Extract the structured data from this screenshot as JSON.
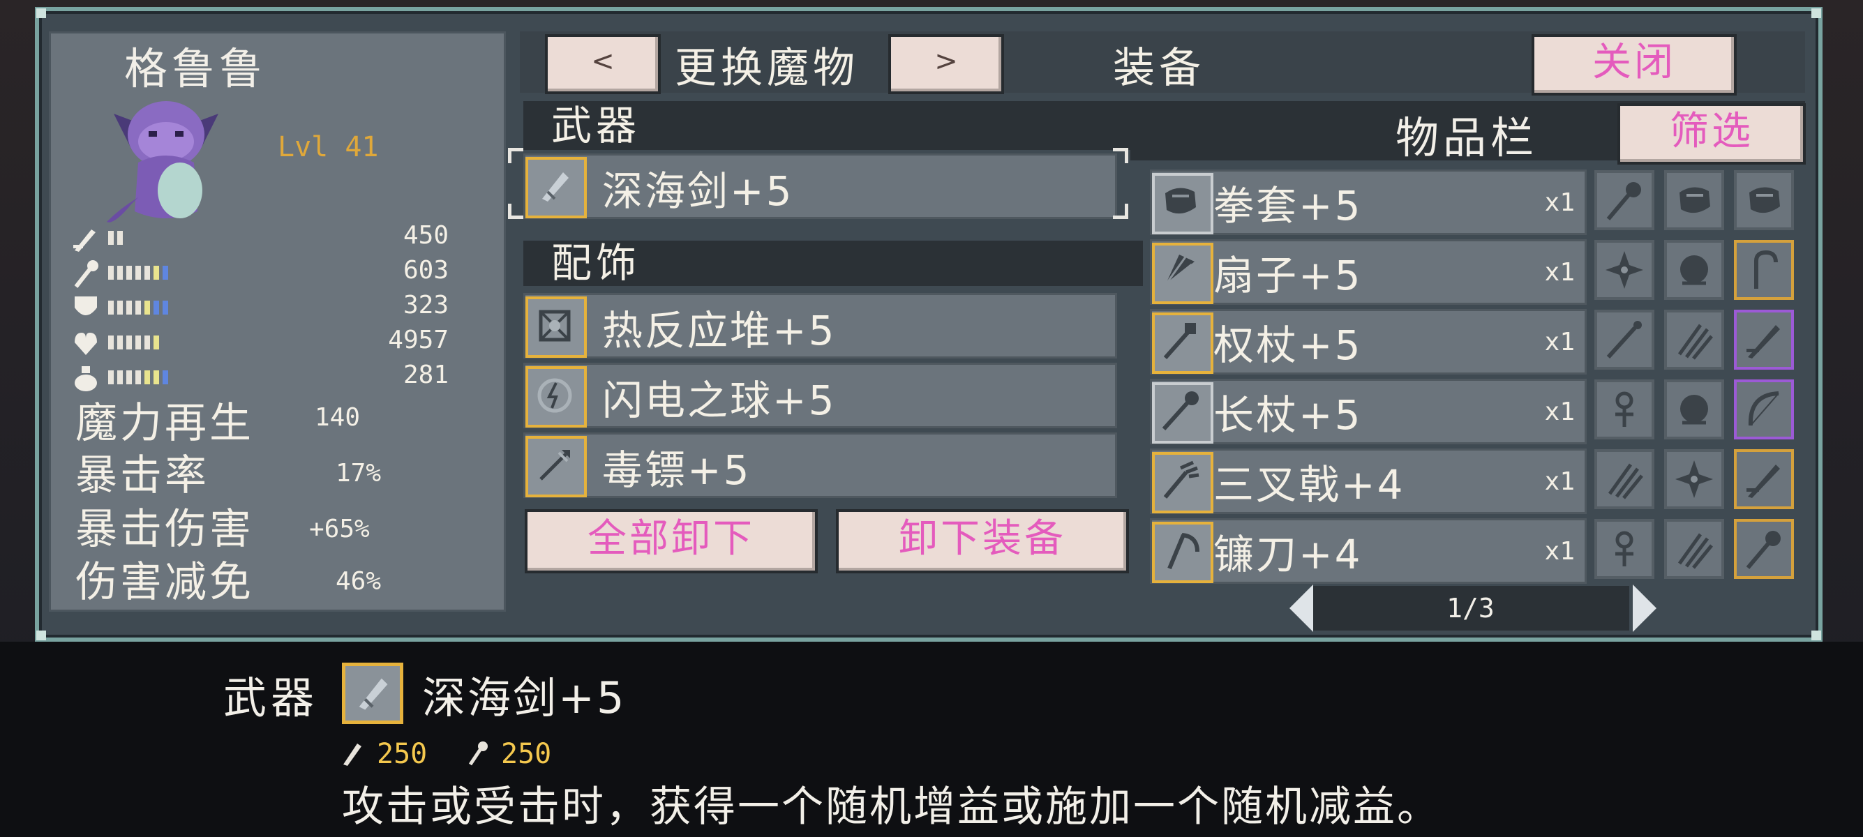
{
  "monster": {
    "name": "格鲁鲁",
    "level": "Lvl 41",
    "stats": [
      {
        "icon": "sword-icon",
        "value": "450",
        "bars": {
          "white": 2,
          "yellow": 0,
          "blue": 0
        }
      },
      {
        "icon": "staff-icon",
        "value": "603",
        "bars": {
          "white": 5,
          "yellow": 1,
          "blue": 1
        }
      },
      {
        "icon": "shield-icon",
        "value": "323",
        "bars": {
          "white": 4,
          "yellow": 1,
          "blue": 2
        }
      },
      {
        "icon": "heart-icon",
        "value": "4957",
        "bars": {
          "white": 5,
          "yellow": 1,
          "blue": 0
        }
      },
      {
        "icon": "potion-icon",
        "value": "281",
        "bars": {
          "white": 4,
          "yellow": 2,
          "blue": 1
        }
      }
    ],
    "extra": [
      {
        "label": "魔力再生",
        "value": "140"
      },
      {
        "label": "暴击率",
        "value": "17%"
      },
      {
        "label": "暴击伤害",
        "value": "+65%"
      },
      {
        "label": "伤害减免",
        "value": "46%"
      }
    ]
  },
  "header": {
    "prev_label": "<",
    "change_label": "更换魔物",
    "next_label": ">",
    "equip_label": "装备",
    "close_label": "关闭"
  },
  "equipped": {
    "weapon_header": "武器",
    "weapon": {
      "name": "深海剑+5",
      "icon": "sea-sword-icon"
    },
    "accessory_header": "配饰",
    "accessories": [
      {
        "name": "热反应堆+5",
        "icon": "reactor-icon"
      },
      {
        "name": "闪电之球+5",
        "icon": "lightning-orb-icon"
      },
      {
        "name": "毒镖+5",
        "icon": "poison-dart-icon"
      }
    ],
    "unequip_all_label": "全部卸下",
    "unequip_label": "卸下装备"
  },
  "inventory": {
    "title": "物品栏",
    "filter_label": "筛选",
    "items": [
      {
        "name": "拳套+5",
        "qty": "x1",
        "icon": "gauntlet-icon",
        "border": "grey"
      },
      {
        "name": "扇子+5",
        "qty": "x1",
        "icon": "fan-icon",
        "border": "gold"
      },
      {
        "name": "权杖+5",
        "qty": "x1",
        "icon": "scepter-icon",
        "border": "gold"
      },
      {
        "name": "长杖+5",
        "qty": "x1",
        "icon": "long-staff-icon",
        "border": "grey"
      },
      {
        "name": "三叉戟+4",
        "qty": "x1",
        "icon": "trident-icon",
        "border": "gold"
      },
      {
        "name": "镰刀+4",
        "qty": "x1",
        "icon": "scythe-icon",
        "border": "gold"
      }
    ],
    "mini_grid": [
      [
        {
          "icon": "mace-icon",
          "border": "grey"
        },
        {
          "icon": "gauntlet-icon",
          "border": "grey"
        },
        {
          "icon": "gauntlet-icon",
          "border": "grey"
        }
      ],
      [
        {
          "icon": "shuriken-icon",
          "border": "grey"
        },
        {
          "icon": "orb-icon",
          "border": "grey"
        },
        {
          "icon": "cane-icon",
          "border": "gold"
        }
      ],
      [
        {
          "icon": "dagger-icon",
          "border": "grey"
        },
        {
          "icon": "claw-icon",
          "border": "grey"
        },
        {
          "icon": "sword-icon",
          "border": "purple"
        }
      ],
      [
        {
          "icon": "ankh-icon",
          "border": "grey"
        },
        {
          "icon": "orb-icon",
          "border": "grey"
        },
        {
          "icon": "bow-icon",
          "border": "purple"
        }
      ],
      [
        {
          "icon": "claw-icon",
          "border": "grey"
        },
        {
          "icon": "shuriken-icon",
          "border": "grey"
        },
        {
          "icon": "sword-icon",
          "border": "gold"
        }
      ],
      [
        {
          "icon": "ankh-icon",
          "border": "grey"
        },
        {
          "icon": "claw-icon",
          "border": "grey"
        },
        {
          "icon": "mace-icon",
          "border": "gold"
        }
      ]
    ],
    "page": "1/3"
  },
  "tooltip": {
    "slot_label": "武器",
    "item_name": "深海剑+5",
    "item_icon": "sea-sword-icon",
    "attack_value": "250",
    "magic_value": "250",
    "description": "攻击或受击时，获得一个随机增益或施加一个随机减益。"
  },
  "colors": {
    "accent_gold": "#e6b23c",
    "filter_pink": "#e45bbd",
    "level_gold": "#e0a83a",
    "frame_teal": "#79a3a0",
    "bar_blue": "#5f86e0",
    "bar_yellow": "#e9e48e"
  }
}
